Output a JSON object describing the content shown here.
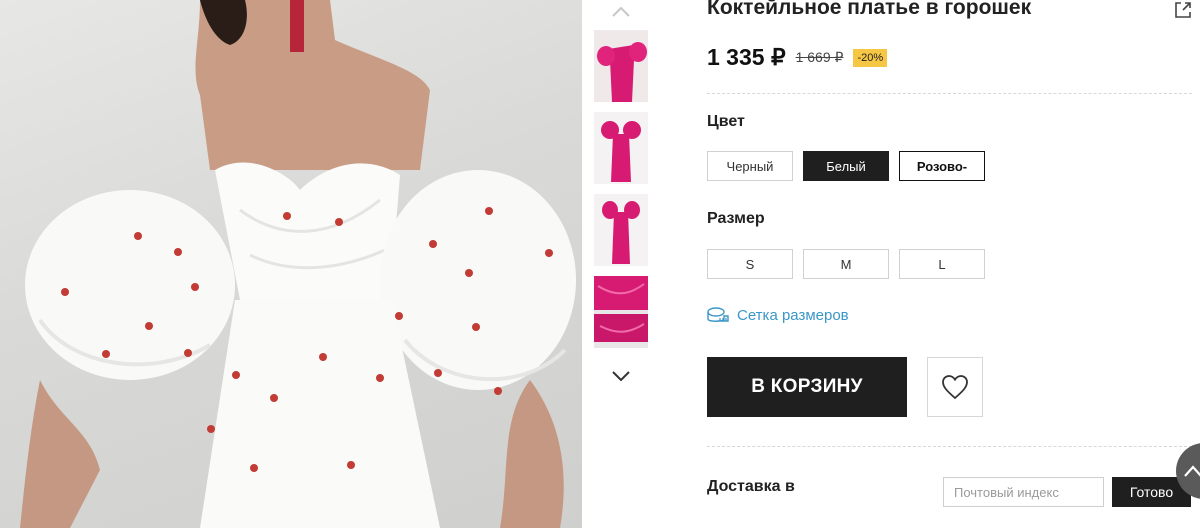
{
  "product": {
    "title": "Коктейльное платье в горошек",
    "price": "1 335 ₽",
    "old_price": "1 669 ₽",
    "discount": "-20%"
  },
  "colors": {
    "label": "Цвет",
    "options": [
      "Черный",
      "Белый",
      "Розово-"
    ],
    "selected": "Белый"
  },
  "sizes": {
    "label": "Размер",
    "options": [
      "S",
      "M",
      "L"
    ]
  },
  "size_chart_label": "Сетка размеров",
  "cart_button_label": "В КОРЗИНУ",
  "delivery": {
    "label": "Доставка в",
    "zip_placeholder": "Почтовый индекс",
    "go_label": "Готово"
  },
  "theme": {
    "accent_dark": "#1f1f1f",
    "link_blue": "#3a97c9",
    "discount_yellow": "#f6c744",
    "thumb_pink": "#d81b72"
  },
  "icons": [
    "share-icon",
    "chevron-up-icon",
    "chevron-down-icon",
    "ruler-icon",
    "heart-icon",
    "chevron-up-icon"
  ]
}
